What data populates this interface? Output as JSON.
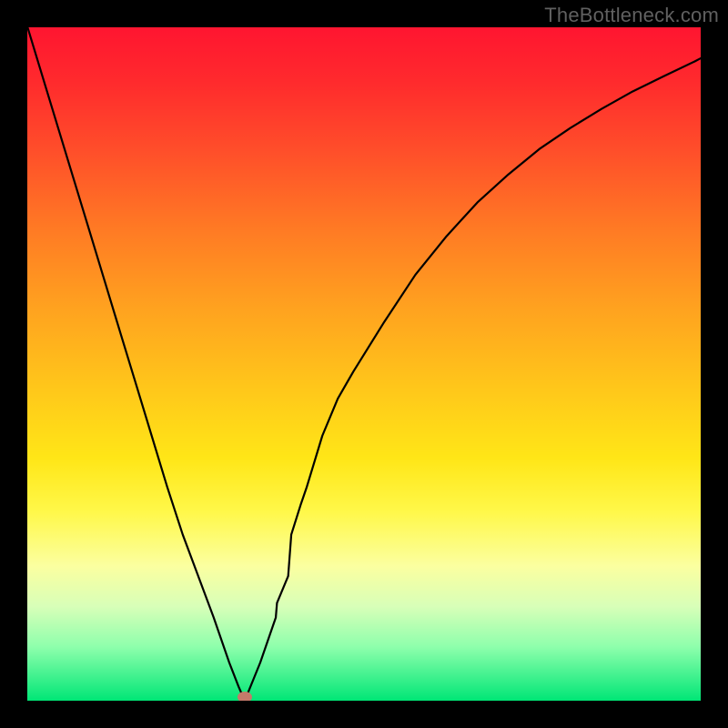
{
  "watermark": "TheBottleneck.com",
  "colors": {
    "curve": "#000000",
    "marker": "#c47a6a",
    "frame": "#000000"
  },
  "chart_data": {
    "type": "line",
    "title": "",
    "xlabel": "",
    "ylabel": "",
    "xlim": [
      0,
      100
    ],
    "ylim": [
      0,
      100
    ],
    "grid": false,
    "legend": false,
    "x": [
      0.04,
      2.34,
      4.65,
      6.95,
      9.26,
      11.56,
      13.86,
      16.17,
      18.47,
      20.77,
      23.08,
      25.38,
      27.68,
      29.99,
      31.37,
      32.29,
      34.59,
      36.9,
      37.08,
      38.74,
      39.2,
      40.58,
      41.51,
      43.81,
      46.11,
      48.42,
      53.02,
      57.63,
      62.24,
      66.84,
      71.45,
      76.05,
      80.66,
      85.27,
      89.87,
      94.48,
      99.08,
      100.0
    ],
    "y": [
      100.0,
      92.42,
      84.83,
      77.25,
      69.67,
      62.09,
      54.5,
      46.92,
      39.34,
      31.76,
      24.67,
      18.51,
      12.35,
      5.66,
      2.1,
      0.0,
      5.66,
      12.35,
      14.52,
      18.51,
      24.67,
      29.05,
      31.76,
      39.34,
      44.86,
      48.88,
      56.27,
      63.25,
      68.96,
      73.99,
      78.16,
      81.93,
      85.06,
      87.88,
      90.46,
      92.72,
      94.92,
      95.4
    ],
    "minimum_point": {
      "x": 32.29,
      "y": 0.0
    },
    "description": "V-shaped bottleneck curve on a red-to-green vertical gradient; minimum near x≈32, marked by a small salmon ellipse."
  }
}
